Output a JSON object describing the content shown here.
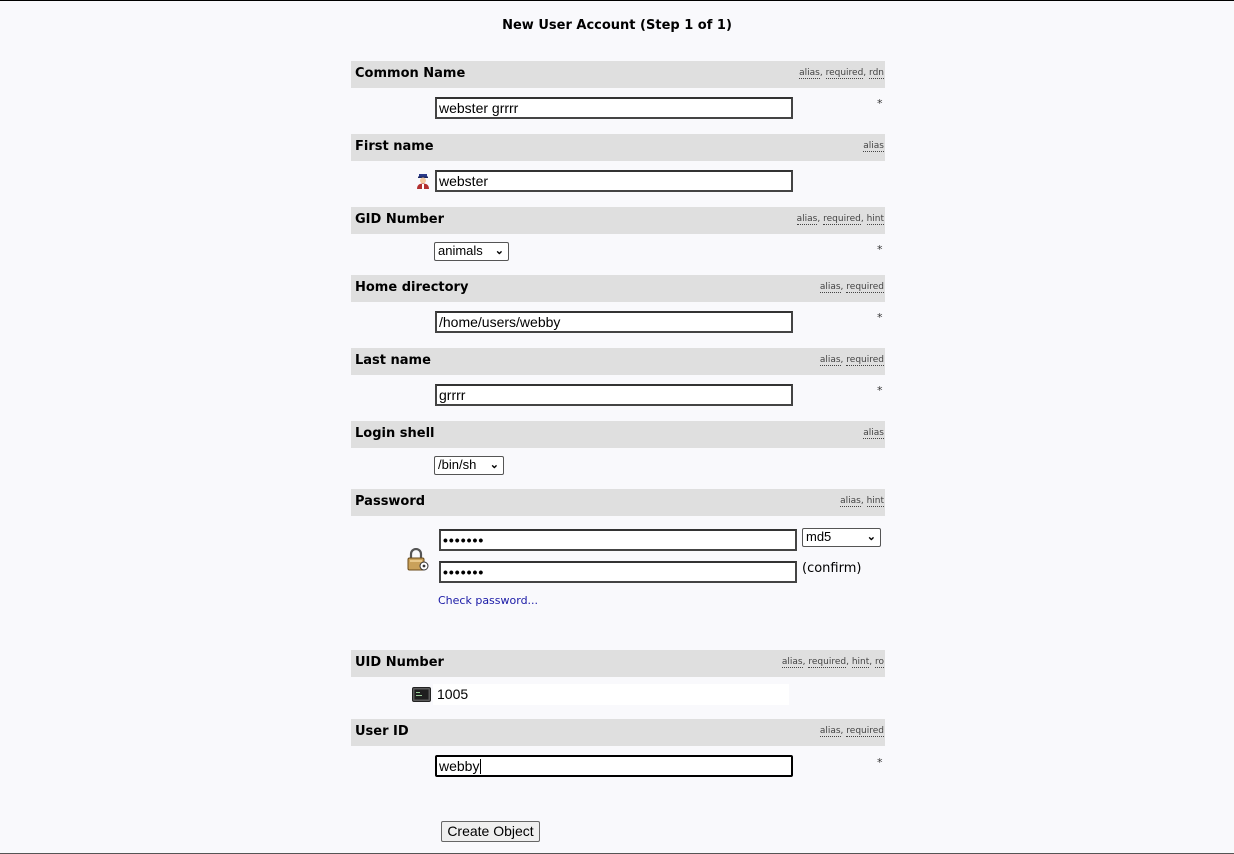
{
  "page_title": "New User Account (Step 1 of 1)",
  "fields": {
    "common_name": {
      "label": "Common Name",
      "meta": [
        "alias",
        "required",
        "rdn"
      ],
      "value": "webster grrrr",
      "required_marker": "*"
    },
    "first_name": {
      "label": "First name",
      "meta": [
        "alias"
      ],
      "value": "webster"
    },
    "gid_number": {
      "label": "GID Number",
      "meta": [
        "alias",
        "required",
        "hint"
      ],
      "selected": "animals",
      "required_marker": "*"
    },
    "home_directory": {
      "label": "Home directory",
      "meta": [
        "alias",
        "required"
      ],
      "value": "/home/users/webby",
      "required_marker": "*"
    },
    "last_name": {
      "label": "Last name",
      "meta": [
        "alias",
        "required"
      ],
      "value": "grrrr",
      "required_marker": "*"
    },
    "login_shell": {
      "label": "Login shell",
      "meta": [
        "alias"
      ],
      "selected": "/bin/sh"
    },
    "password": {
      "label": "Password",
      "meta": [
        "alias",
        "hint"
      ],
      "value": "•••••••",
      "confirm_value": "•••••••",
      "hash_selected": "md5",
      "confirm_label": "(confirm)",
      "check_link": "Check password..."
    },
    "uid_number": {
      "label": "UID Number",
      "meta": [
        "alias",
        "required",
        "hint",
        "ro"
      ],
      "value": "1005"
    },
    "user_id": {
      "label": "User ID",
      "meta": [
        "alias",
        "required"
      ],
      "value": "webby",
      "required_marker": "*"
    }
  },
  "submit_label": "Create Object",
  "icons": {
    "first_name": "user-icon",
    "password": "lock-icon",
    "uid_number": "terminal-icon"
  }
}
